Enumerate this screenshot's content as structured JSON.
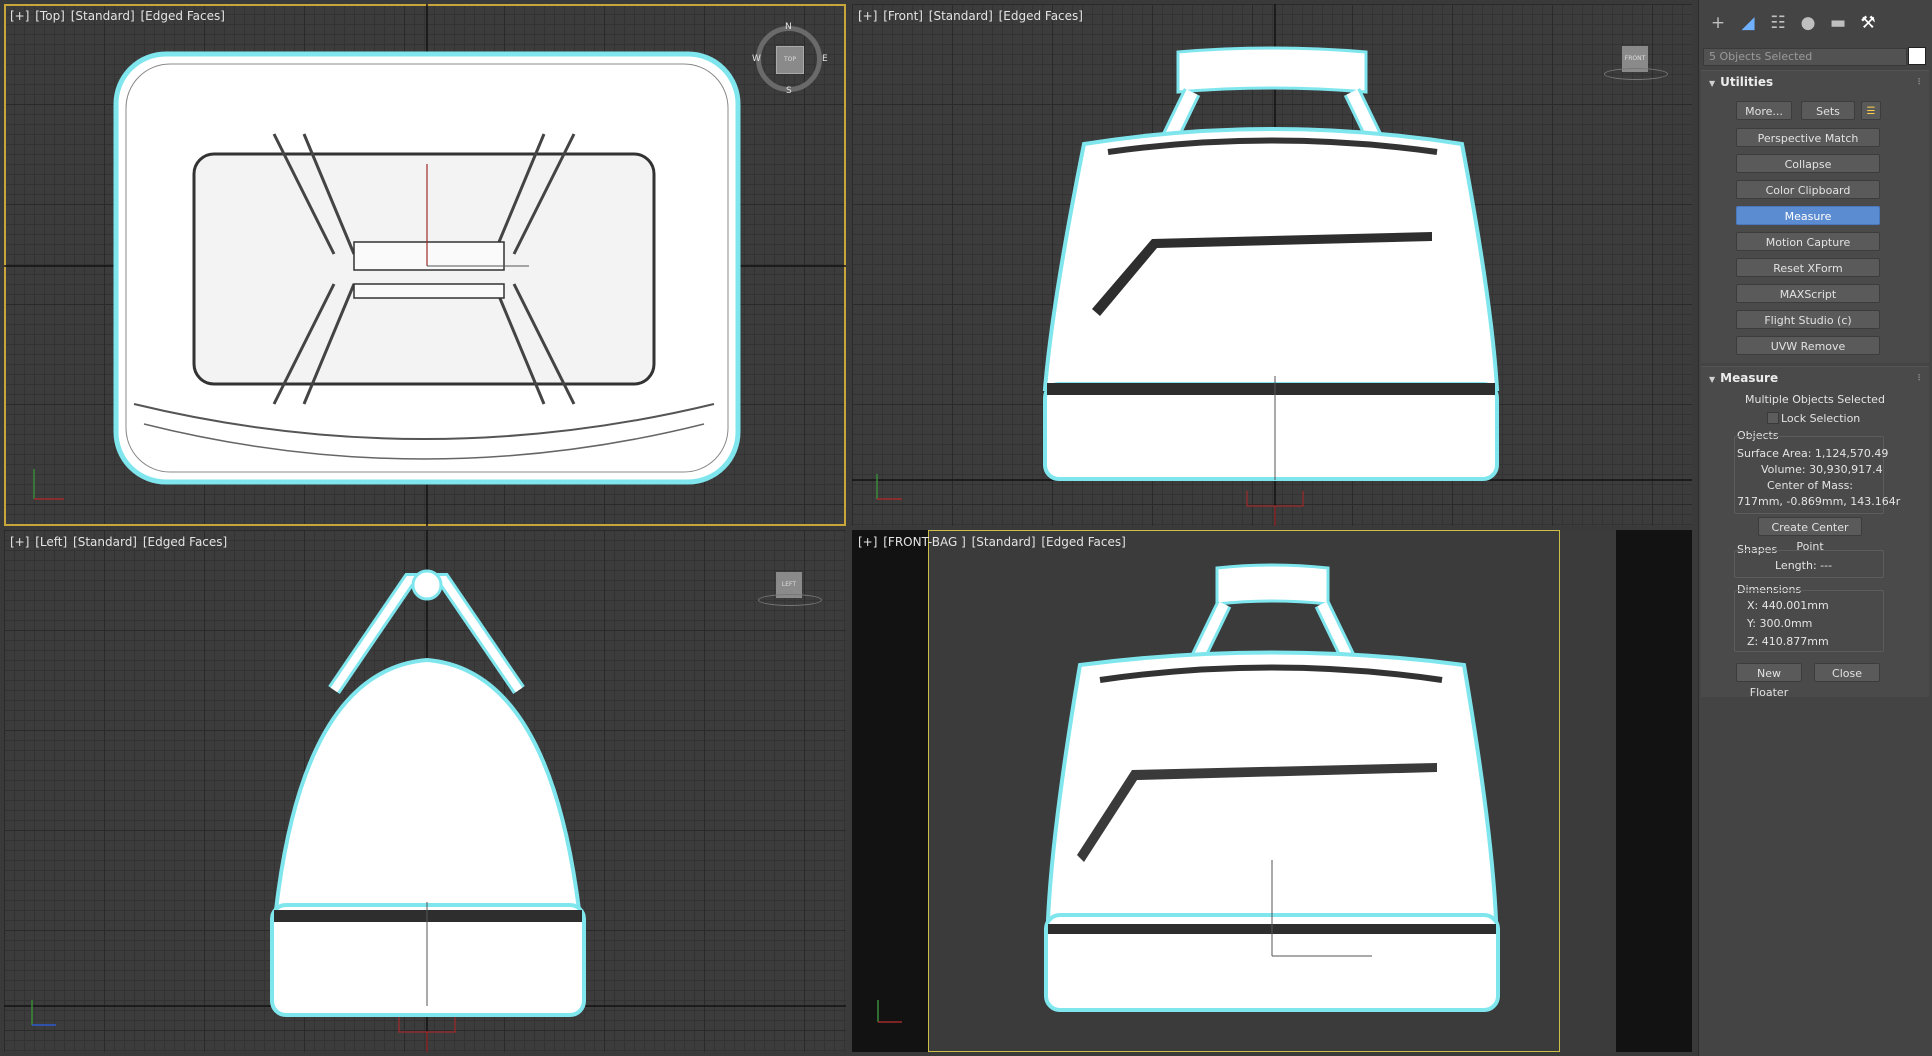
{
  "viewports": {
    "top": {
      "plus": "[+]",
      "view": "[Top]",
      "shading": "[Standard]",
      "mode": "[Edged Faces]",
      "cube_label": "TOP",
      "compass": {
        "n": "N",
        "s": "S",
        "e": "E",
        "w": "W"
      }
    },
    "front": {
      "plus": "[+]",
      "view": "[Front]",
      "shading": "[Standard]",
      "mode": "[Edged Faces]",
      "cube_label": "FRONT"
    },
    "left": {
      "plus": "[+]",
      "view": "[Left]",
      "shading": "[Standard]",
      "mode": "[Edged Faces]",
      "cube_label": "LEFT"
    },
    "cam": {
      "plus": "[+]",
      "view": "[FRONT-BAG ]",
      "shading": "[Standard]",
      "mode": "[Edged Faces]"
    },
    "axis": {
      "x": "x",
      "y": "y",
      "z": "z"
    }
  },
  "panel": {
    "tabs": [
      "create-icon",
      "modify-icon",
      "hierarchy-icon",
      "motion-icon",
      "display-icon",
      "utilities-icon"
    ],
    "selection_text": "5 Objects Selected",
    "utilities": {
      "title": "Utilities",
      "more": "More...",
      "sets": "Sets",
      "buttons": [
        "Perspective Match",
        "Collapse",
        "Color Clipboard",
        "Measure",
        "Motion Capture",
        "Reset XForm",
        "MAXScript",
        "Flight Studio (c)",
        "UVW Remove"
      ]
    },
    "measure": {
      "title": "Measure",
      "status": "Multiple Objects Selected",
      "lock": "Lock Selection",
      "objects_label": "Objects",
      "surface_area": "Surface Area:  1,124,570.49",
      "volume": "Volume:  30,930,917.4",
      "center_label": "Center of Mass:",
      "center_value": "717mm, -0.869mm, 143.164r",
      "create_center": "Create Center Point",
      "shapes_label": "Shapes",
      "length": "Length:  ---",
      "dimensions_label": "Dimensions",
      "dim_x": "X:   440.001mm",
      "dim_y": "Y:   300.0mm",
      "dim_z": "Z:   410.877mm",
      "new_floater": "New Floater",
      "close": "Close"
    }
  },
  "colors": {
    "accent_active": "#5b8bd1",
    "selection_outline": "#7fe6ee",
    "active_viewport_border": "#c9a63c",
    "grid_main": "#2a2a2a"
  }
}
